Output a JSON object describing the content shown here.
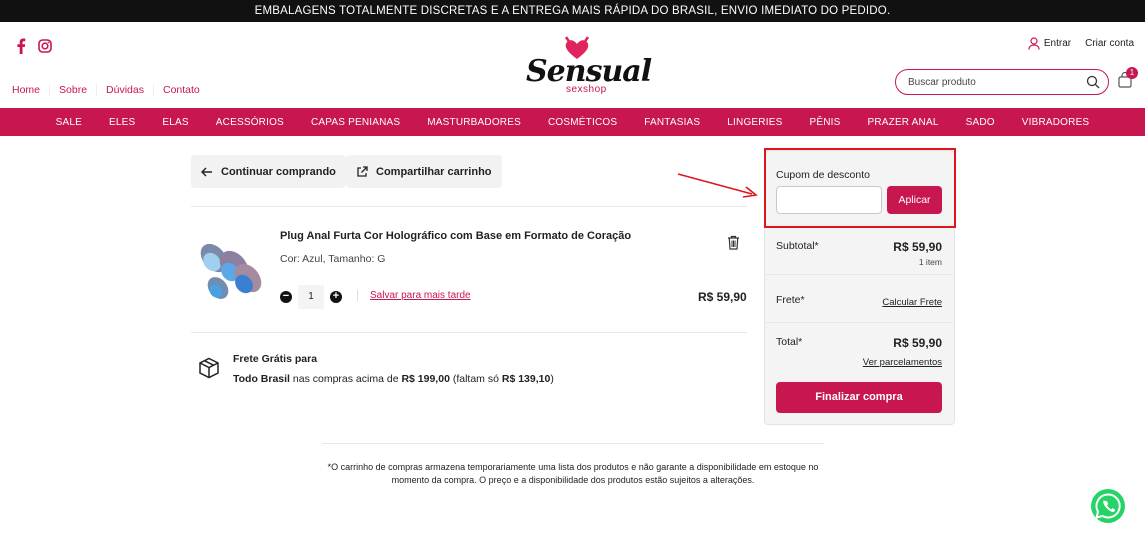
{
  "topbar": {
    "text": "EMBALAGENS TOTALMENTE DISCRETAS E A ENTREGA MAIS RÁPIDA DO BRASIL, ENVIO IMEDIATO DO PEDIDO."
  },
  "header": {
    "logo_word": "Sensual",
    "logo_sub": "sexshop",
    "nav": [
      "Home",
      "Sobre",
      "Dúvidas",
      "Contato"
    ],
    "entrar": "Entrar",
    "criar_conta": "Criar conta",
    "search_placeholder": "Buscar produto",
    "cart_count": "1"
  },
  "categories": [
    "SALE",
    "ELES",
    "ELAS",
    "ACESSÓRIOS",
    "CAPAS PENIANAS",
    "MASTURBADORES",
    "COSMÉTICOS",
    "FANTASIAS",
    "LINGERIES",
    "PÊNIS",
    "PRAZER ANAL",
    "SADO",
    "VIBRADORES"
  ],
  "actions": {
    "continue": "Continuar comprando",
    "share": "Compartilhar carrinho"
  },
  "product": {
    "title": "Plug Anal Furta Cor Holográfico com Base em Formato de Coração",
    "variant": "Cor: Azul, Tamanho: G",
    "qty": "1",
    "save_later": "Salvar para mais tarde",
    "price": "R$ 59,90"
  },
  "shipping": {
    "line1": "Frete Grátis para",
    "line2_bold": "Todo Brasil",
    "line2_text": " nas compras acima de ",
    "threshold": "R$ 199,00",
    "remaining_text": " (faltam só ",
    "remaining": "R$ 139,10",
    "close": ")"
  },
  "summary": {
    "coupon_label": "Cupom de desconto",
    "apply": "Aplicar",
    "subtotal_label": "Subtotal*",
    "subtotal": "R$ 59,90",
    "items": "1 item",
    "frete_label": "Frete*",
    "calc_frete": "Calcular Frete",
    "total_label": "Total*",
    "total": "R$ 59,90",
    "installments": "Ver parcelamentos",
    "checkout": "Finalizar compra"
  },
  "disclaimer": {
    "line1": "*O carrinho de compras armazena temporariamente uma lista dos produtos e não garante a disponibilidade em estoque no",
    "line2": "momento da compra. O preço e a disponibilidade dos produtos estão sujeitos a alterações."
  },
  "colors": {
    "brand": "#c8174f",
    "annotation": "#e0141b"
  }
}
